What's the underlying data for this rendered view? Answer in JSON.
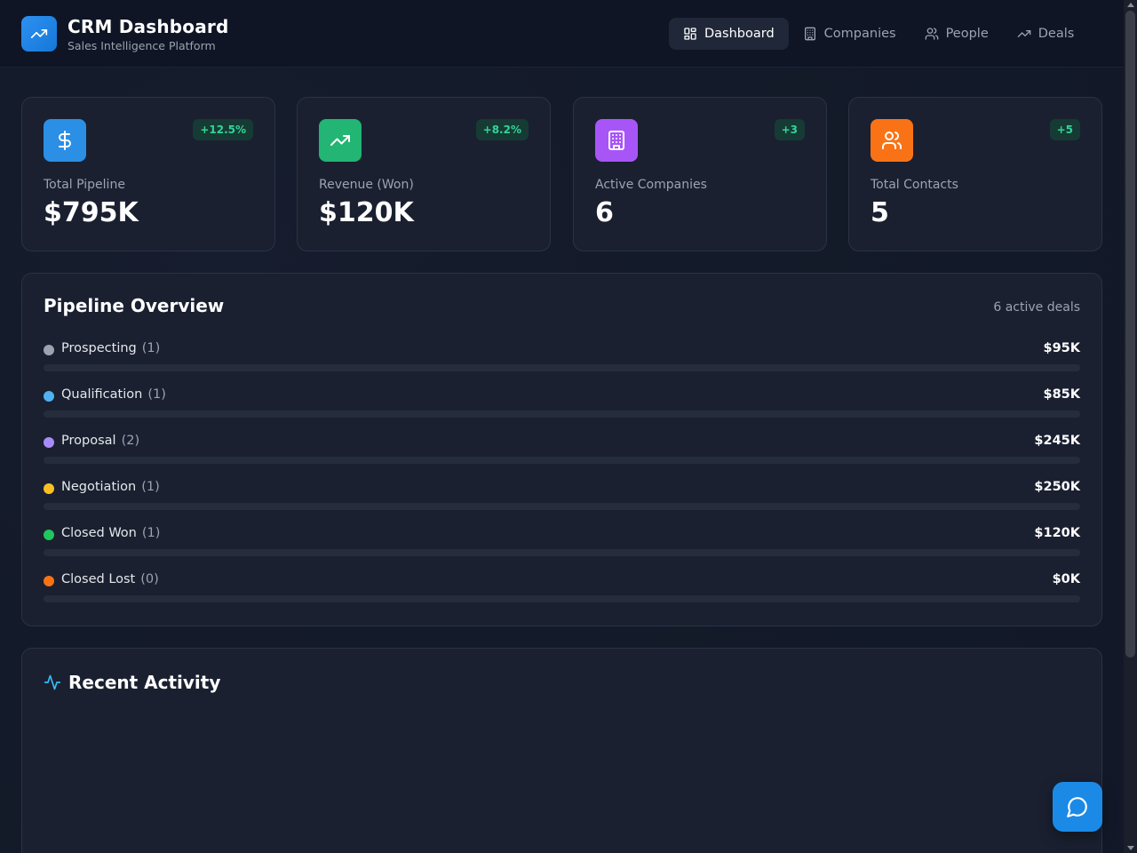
{
  "header": {
    "title": "CRM Dashboard",
    "subtitle": "Sales Intelligence Platform",
    "logo_icon": "trending-up-icon"
  },
  "nav": [
    {
      "label": "Dashboard",
      "icon": "grid-icon",
      "active": true
    },
    {
      "label": "Companies",
      "icon": "building-icon",
      "active": false
    },
    {
      "label": "People",
      "icon": "users-icon",
      "active": false
    },
    {
      "label": "Deals",
      "icon": "trending-up-icon",
      "active": false
    }
  ],
  "stats": [
    {
      "label": "Total Pipeline",
      "value": "$795K",
      "badge": "+12.5%",
      "icon": "dollar-icon",
      "color": "#2b8fe6"
    },
    {
      "label": "Revenue (Won)",
      "value": "$120K",
      "badge": "+8.2%",
      "icon": "trending-up-icon",
      "color": "#22b573"
    },
    {
      "label": "Active Companies",
      "value": "6",
      "badge": "+3",
      "icon": "building-icon",
      "color": "#a855f7"
    },
    {
      "label": "Total Contacts",
      "value": "5",
      "badge": "+5",
      "icon": "users-icon",
      "color": "#f97316"
    }
  ],
  "pipeline": {
    "title": "Pipeline Overview",
    "meta": "6 active deals",
    "stages": [
      {
        "name": "Prospecting",
        "count": "(1)",
        "amount": "$95K",
        "color": "#9ca3af",
        "fill": 0
      },
      {
        "name": "Qualification",
        "count": "(1)",
        "amount": "$85K",
        "color": "#4fb2f2",
        "fill": 0
      },
      {
        "name": "Proposal",
        "count": "(2)",
        "amount": "$245K",
        "color": "#a78bfa",
        "fill": 0
      },
      {
        "name": "Negotiation",
        "count": "(1)",
        "amount": "$250K",
        "color": "#fbbf24",
        "fill": 0
      },
      {
        "name": "Closed Won",
        "count": "(1)",
        "amount": "$120K",
        "color": "#22c55e",
        "fill": 0
      },
      {
        "name": "Closed Lost",
        "count": "(0)",
        "amount": "$0K",
        "color": "#f97316",
        "fill": 0
      }
    ]
  },
  "activity": {
    "title": "Recent Activity",
    "icon": "activity-icon"
  },
  "chat": {
    "icon": "chat-bubble-icon"
  }
}
